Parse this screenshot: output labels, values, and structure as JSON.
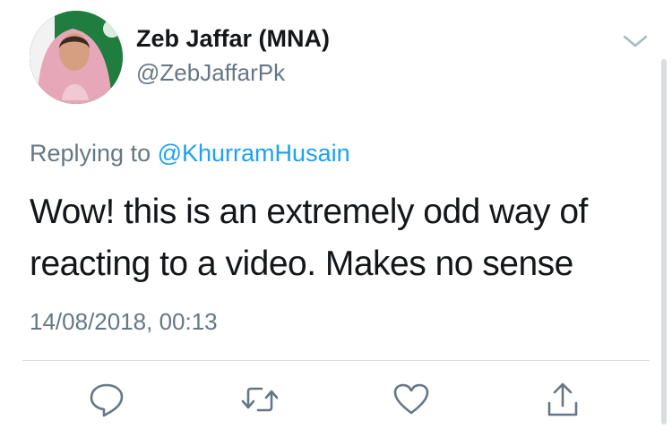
{
  "tweet": {
    "display_name": "Zeb Jaffar (MNA)",
    "handle": "@ZebJaffarPk",
    "replying_prefix": "Replying to",
    "replying_to": "@KhurramHusain",
    "text": "Wow! this is an extremely odd way of reacting to a video. Makes no sense",
    "timestamp": "14/08/2018, 00:13"
  },
  "actions": {
    "icons": [
      "reply-icon",
      "retweet-icon",
      "like-icon",
      "share-icon"
    ]
  },
  "colors": {
    "primary_text": "#14171a",
    "secondary_text": "#657786",
    "link": "#1da1f2",
    "icon": "#657786",
    "divider": "#d7dde2"
  }
}
